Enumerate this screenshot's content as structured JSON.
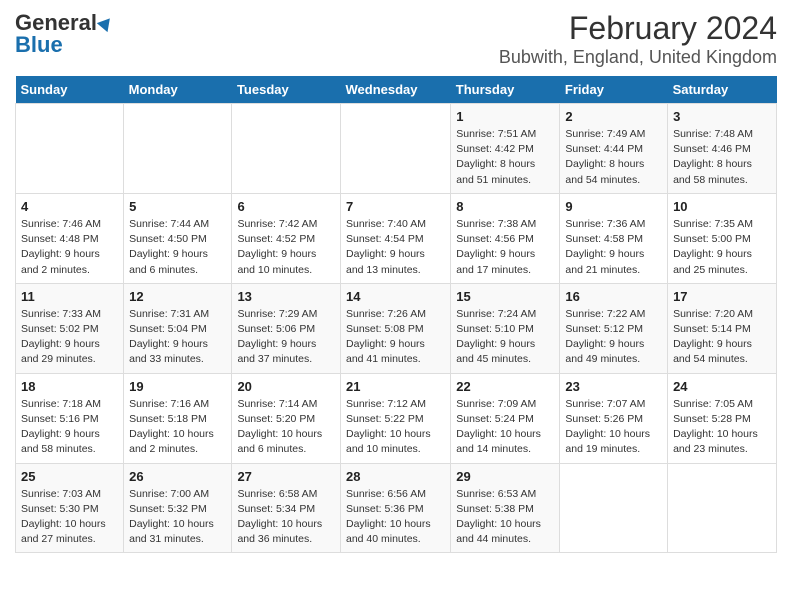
{
  "header": {
    "logo_line1": "General",
    "logo_line2": "Blue",
    "title": "February 2024",
    "subtitle": "Bubwith, England, United Kingdom"
  },
  "weekdays": [
    "Sunday",
    "Monday",
    "Tuesday",
    "Wednesday",
    "Thursday",
    "Friday",
    "Saturday"
  ],
  "weeks": [
    [
      {
        "day": "",
        "info": ""
      },
      {
        "day": "",
        "info": ""
      },
      {
        "day": "",
        "info": ""
      },
      {
        "day": "",
        "info": ""
      },
      {
        "day": "1",
        "info": "Sunrise: 7:51 AM\nSunset: 4:42 PM\nDaylight: 8 hours\nand 51 minutes."
      },
      {
        "day": "2",
        "info": "Sunrise: 7:49 AM\nSunset: 4:44 PM\nDaylight: 8 hours\nand 54 minutes."
      },
      {
        "day": "3",
        "info": "Sunrise: 7:48 AM\nSunset: 4:46 PM\nDaylight: 8 hours\nand 58 minutes."
      }
    ],
    [
      {
        "day": "4",
        "info": "Sunrise: 7:46 AM\nSunset: 4:48 PM\nDaylight: 9 hours\nand 2 minutes."
      },
      {
        "day": "5",
        "info": "Sunrise: 7:44 AM\nSunset: 4:50 PM\nDaylight: 9 hours\nand 6 minutes."
      },
      {
        "day": "6",
        "info": "Sunrise: 7:42 AM\nSunset: 4:52 PM\nDaylight: 9 hours\nand 10 minutes."
      },
      {
        "day": "7",
        "info": "Sunrise: 7:40 AM\nSunset: 4:54 PM\nDaylight: 9 hours\nand 13 minutes."
      },
      {
        "day": "8",
        "info": "Sunrise: 7:38 AM\nSunset: 4:56 PM\nDaylight: 9 hours\nand 17 minutes."
      },
      {
        "day": "9",
        "info": "Sunrise: 7:36 AM\nSunset: 4:58 PM\nDaylight: 9 hours\nand 21 minutes."
      },
      {
        "day": "10",
        "info": "Sunrise: 7:35 AM\nSunset: 5:00 PM\nDaylight: 9 hours\nand 25 minutes."
      }
    ],
    [
      {
        "day": "11",
        "info": "Sunrise: 7:33 AM\nSunset: 5:02 PM\nDaylight: 9 hours\nand 29 minutes."
      },
      {
        "day": "12",
        "info": "Sunrise: 7:31 AM\nSunset: 5:04 PM\nDaylight: 9 hours\nand 33 minutes."
      },
      {
        "day": "13",
        "info": "Sunrise: 7:29 AM\nSunset: 5:06 PM\nDaylight: 9 hours\nand 37 minutes."
      },
      {
        "day": "14",
        "info": "Sunrise: 7:26 AM\nSunset: 5:08 PM\nDaylight: 9 hours\nand 41 minutes."
      },
      {
        "day": "15",
        "info": "Sunrise: 7:24 AM\nSunset: 5:10 PM\nDaylight: 9 hours\nand 45 minutes."
      },
      {
        "day": "16",
        "info": "Sunrise: 7:22 AM\nSunset: 5:12 PM\nDaylight: 9 hours\nand 49 minutes."
      },
      {
        "day": "17",
        "info": "Sunrise: 7:20 AM\nSunset: 5:14 PM\nDaylight: 9 hours\nand 54 minutes."
      }
    ],
    [
      {
        "day": "18",
        "info": "Sunrise: 7:18 AM\nSunset: 5:16 PM\nDaylight: 9 hours\nand 58 minutes."
      },
      {
        "day": "19",
        "info": "Sunrise: 7:16 AM\nSunset: 5:18 PM\nDaylight: 10 hours\nand 2 minutes."
      },
      {
        "day": "20",
        "info": "Sunrise: 7:14 AM\nSunset: 5:20 PM\nDaylight: 10 hours\nand 6 minutes."
      },
      {
        "day": "21",
        "info": "Sunrise: 7:12 AM\nSunset: 5:22 PM\nDaylight: 10 hours\nand 10 minutes."
      },
      {
        "day": "22",
        "info": "Sunrise: 7:09 AM\nSunset: 5:24 PM\nDaylight: 10 hours\nand 14 minutes."
      },
      {
        "day": "23",
        "info": "Sunrise: 7:07 AM\nSunset: 5:26 PM\nDaylight: 10 hours\nand 19 minutes."
      },
      {
        "day": "24",
        "info": "Sunrise: 7:05 AM\nSunset: 5:28 PM\nDaylight: 10 hours\nand 23 minutes."
      }
    ],
    [
      {
        "day": "25",
        "info": "Sunrise: 7:03 AM\nSunset: 5:30 PM\nDaylight: 10 hours\nand 27 minutes."
      },
      {
        "day": "26",
        "info": "Sunrise: 7:00 AM\nSunset: 5:32 PM\nDaylight: 10 hours\nand 31 minutes."
      },
      {
        "day": "27",
        "info": "Sunrise: 6:58 AM\nSunset: 5:34 PM\nDaylight: 10 hours\nand 36 minutes."
      },
      {
        "day": "28",
        "info": "Sunrise: 6:56 AM\nSunset: 5:36 PM\nDaylight: 10 hours\nand 40 minutes."
      },
      {
        "day": "29",
        "info": "Sunrise: 6:53 AM\nSunset: 5:38 PM\nDaylight: 10 hours\nand 44 minutes."
      },
      {
        "day": "",
        "info": ""
      },
      {
        "day": "",
        "info": ""
      }
    ]
  ]
}
